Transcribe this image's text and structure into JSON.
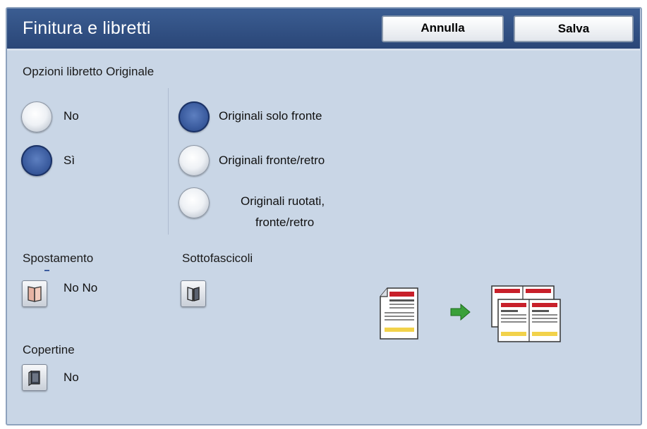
{
  "header": {
    "title": "Finitura e libretti",
    "cancel_label": "Annulla",
    "save_label": "Salva"
  },
  "original_booklet": {
    "label": "Opzioni libretto Originale",
    "options": [
      {
        "label": "No",
        "selected": false
      },
      {
        "label": "Sì",
        "selected": true
      }
    ]
  },
  "sides": {
    "options": [
      {
        "label": "Originali solo fronte",
        "selected": true
      },
      {
        "label": "Originali fronte/retro",
        "selected": false
      },
      {
        "label_line1": "Originali ruotati,",
        "label_line2": "fronte/retro",
        "selected": false
      }
    ]
  },
  "shift": {
    "label": "Spostamento",
    "value": "No No"
  },
  "subsets": {
    "label": "Sottofascicoli"
  },
  "covers": {
    "label": "Copertine",
    "value": "No"
  },
  "colors": {
    "titlebar": "#2a4677",
    "panel": "#c9d6e6",
    "radio_selected": "#3b5c9f",
    "arrow": "#3aa03a",
    "doc_header": "#c8202a",
    "doc_stripe": "#f2d24a"
  },
  "icons": {
    "shift": "booklet-shift-icon",
    "subsets": "booklet-subsets-icon",
    "covers": "booklet-cover-icon",
    "illustration": "single-original-to-booklet-illustration"
  }
}
